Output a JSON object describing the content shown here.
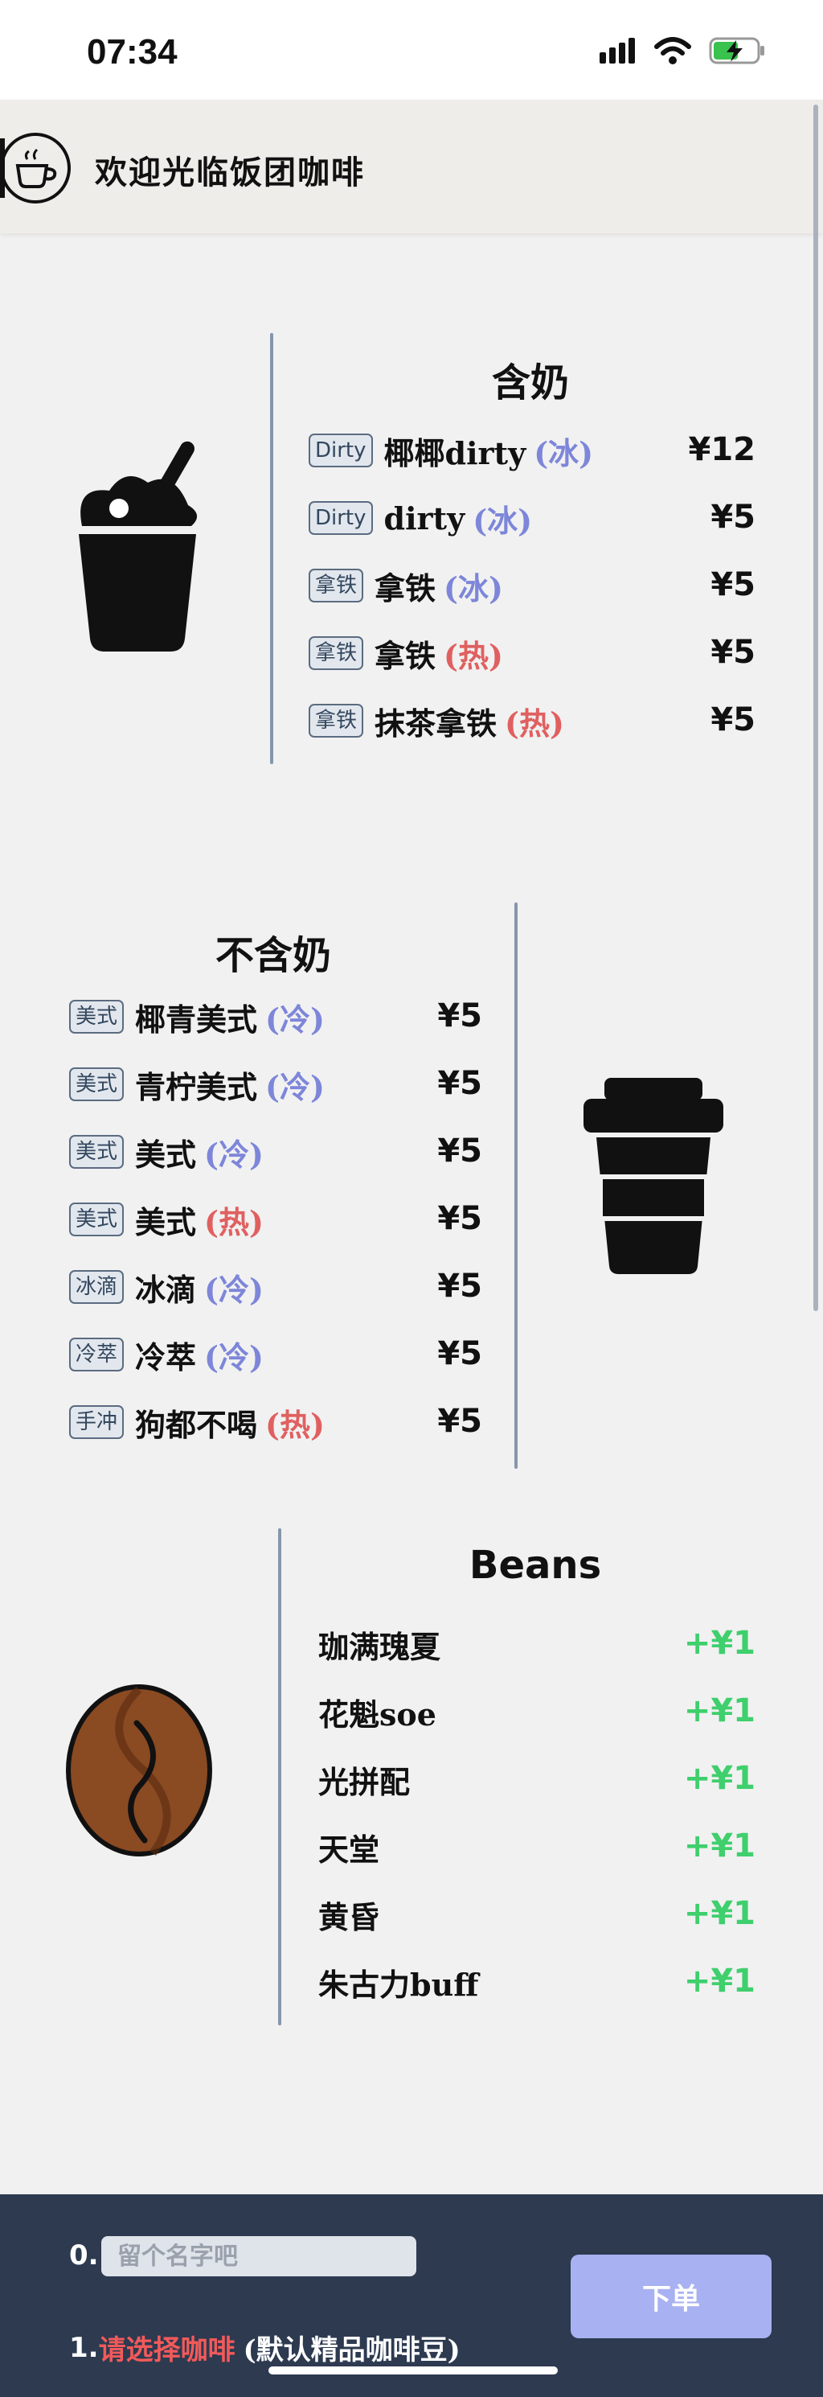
{
  "status_bar": {
    "time": "07:34"
  },
  "header": {
    "title": "欢迎光临饭团咖啡"
  },
  "milk_section": {
    "title": "含奶",
    "items": [
      {
        "tag": "Dirty",
        "name": "椰椰dirty",
        "temp": "(冰)",
        "price": "¥12"
      },
      {
        "tag": "Dirty",
        "name": "dirty",
        "temp": "(冰)",
        "price": "¥5"
      },
      {
        "tag": "拿铁",
        "name": "拿铁",
        "temp": "(冰)",
        "price": "¥5"
      },
      {
        "tag": "拿铁",
        "name": "拿铁",
        "temp": "(热)",
        "price": "¥5"
      },
      {
        "tag": "拿铁",
        "name": "抹茶拿铁",
        "temp": "(热)",
        "price": "¥5"
      }
    ]
  },
  "no_milk_section": {
    "title": "不含奶",
    "items": [
      {
        "tag": "美式",
        "name": "椰青美式",
        "temp": "(冷)",
        "price": "¥5"
      },
      {
        "tag": "美式",
        "name": "青柠美式",
        "temp": "(冷)",
        "price": "¥5"
      },
      {
        "tag": "美式",
        "name": "美式",
        "temp": "(冷)",
        "price": "¥5"
      },
      {
        "tag": "美式",
        "name": "美式",
        "temp": "(热)",
        "price": "¥5"
      },
      {
        "tag": "冰滴",
        "name": "冰滴",
        "temp": "(冷)",
        "price": "¥5"
      },
      {
        "tag": "冷萃",
        "name": "冷萃",
        "temp": "(冷)",
        "price": "¥5"
      },
      {
        "tag": "手冲",
        "name": "狗都不喝",
        "temp": "(热)",
        "price": "¥5"
      }
    ]
  },
  "beans_section": {
    "title": "Beans",
    "items": [
      {
        "name": "珈满瑰夏",
        "price": "+¥1"
      },
      {
        "name": "花魁soe",
        "price": "+¥1"
      },
      {
        "name": "光拼配",
        "price": "+¥1"
      },
      {
        "name": "天堂",
        "price": "+¥1"
      },
      {
        "name": "黄昏",
        "price": "+¥1"
      },
      {
        "name": "朱古力buff",
        "price": "+¥1"
      }
    ]
  },
  "order_panel": {
    "step0_label": "0.",
    "name_placeholder": "留个名字吧",
    "step1_label": "1.",
    "select_hint": "请选择咖啡",
    "default_note": "(默认精品咖啡豆)",
    "order_button": "下单"
  },
  "colors": {
    "cold": "#7d86d9",
    "hot": "#e06060",
    "bean_price": "#3fcf6d",
    "panel": "#2d3a50",
    "button": "#a8b1f1"
  }
}
